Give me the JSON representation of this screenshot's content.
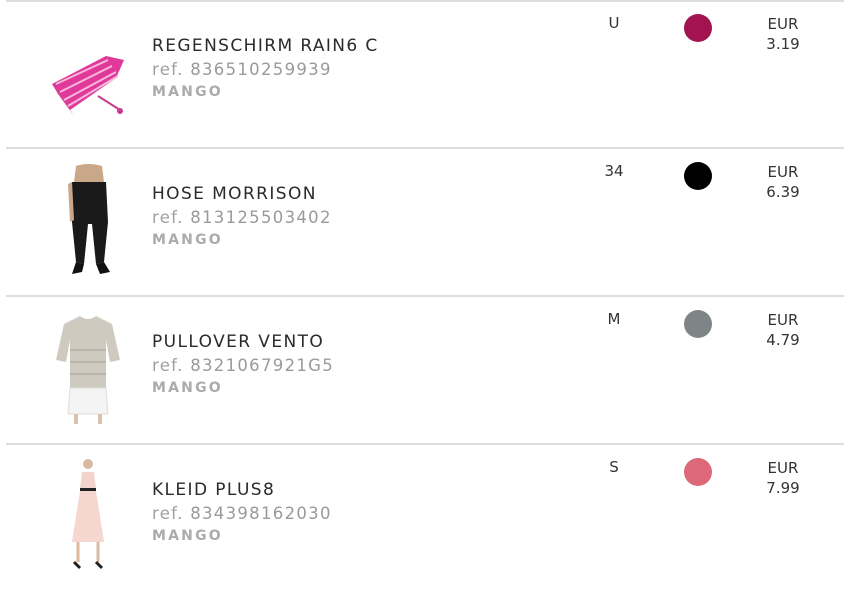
{
  "items": [
    {
      "name": "REGENSCHIRM RAIN6 C",
      "ref_prefix": "ref.",
      "ref": "836510259939",
      "brand": "MANGO",
      "size": "U",
      "color": "#a3134f",
      "currency": "EUR",
      "price": "3.19",
      "image": "umbrella-icon"
    },
    {
      "name": "HOSE MORRISON",
      "ref_prefix": "ref.",
      "ref": "813125503402",
      "brand": "MANGO",
      "size": "34",
      "color": "#000000",
      "currency": "EUR",
      "price": "6.39",
      "image": "trousers-icon"
    },
    {
      "name": "PULLOVER VENTO",
      "ref_prefix": "ref.",
      "ref": "8321067921G5",
      "brand": "MANGO",
      "size": "M",
      "color": "#7f8486",
      "currency": "EUR",
      "price": "4.79",
      "image": "sweater-icon"
    },
    {
      "name": "KLEID PLUS8",
      "ref_prefix": "ref.",
      "ref": "834398162030",
      "brand": "MANGO",
      "size": "S",
      "color": "#dc6878",
      "currency": "EUR",
      "price": "7.99",
      "image": "dress-icon"
    }
  ]
}
